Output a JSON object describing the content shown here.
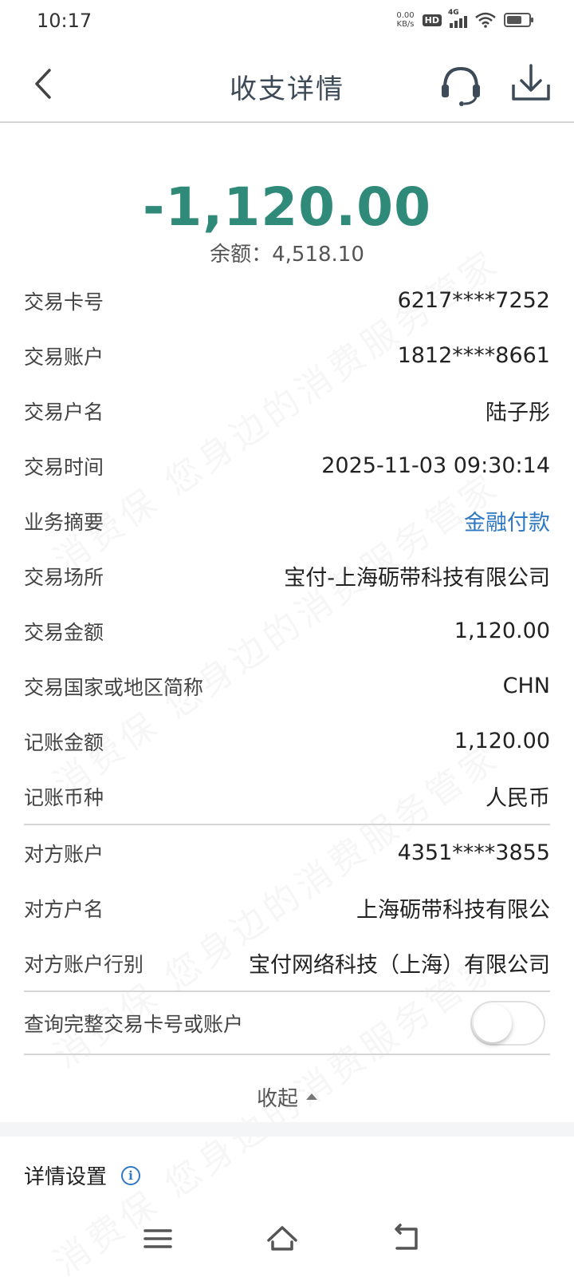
{
  "status_bar": {
    "time": "10:17",
    "net_speed_value": "0.00",
    "net_speed_unit": "KB/s",
    "hd_badge": "HD",
    "network_type": "4G",
    "battery_level": 0.7
  },
  "nav": {
    "title": "收支详情",
    "back_icon": "chevron-left-icon",
    "service_icon": "headset-icon",
    "download_icon": "download-icon"
  },
  "summary": {
    "amount": "-1,120.00",
    "balance": "余额：4,518.10"
  },
  "details": [
    {
      "label": "交易卡号",
      "value": "6217****7252"
    },
    {
      "label": "交易账户",
      "value": "1812****8661"
    },
    {
      "label": "交易户名",
      "value": "陆子彤"
    },
    {
      "label": "交易时间",
      "value": "2025-11-03 09:30:14"
    },
    {
      "label": "业务摘要",
      "value": "金融付款"
    },
    {
      "label": "交易场所",
      "value": "宝付-上海砺带科技有限公司"
    },
    {
      "label": "交易金额",
      "value": "1,120.00"
    },
    {
      "label": "交易国家或地区简称",
      "value": "CHN"
    },
    {
      "label": "记账金额",
      "value": "1,120.00"
    },
    {
      "label": "记账币种",
      "value": "人民币"
    }
  ],
  "counterparty": [
    {
      "label": "对方账户",
      "value": "4351****3855"
    },
    {
      "label": "对方户名",
      "value": "上海砺带科技有限公"
    },
    {
      "label": "对方账户行别",
      "value": "宝付网络科技（上海）有限公司"
    }
  ],
  "toggle": {
    "label": "查询完整交易卡号或账户",
    "on": false
  },
  "collapse_label": "收起",
  "settings": {
    "title": "详情设置",
    "info_glyph": "i"
  },
  "watermark_text": "消费保 您身边的消费服务管家",
  "colors": {
    "amount": "#2f8a7a",
    "link": "#2f78c4",
    "title": "#3d4a57"
  }
}
